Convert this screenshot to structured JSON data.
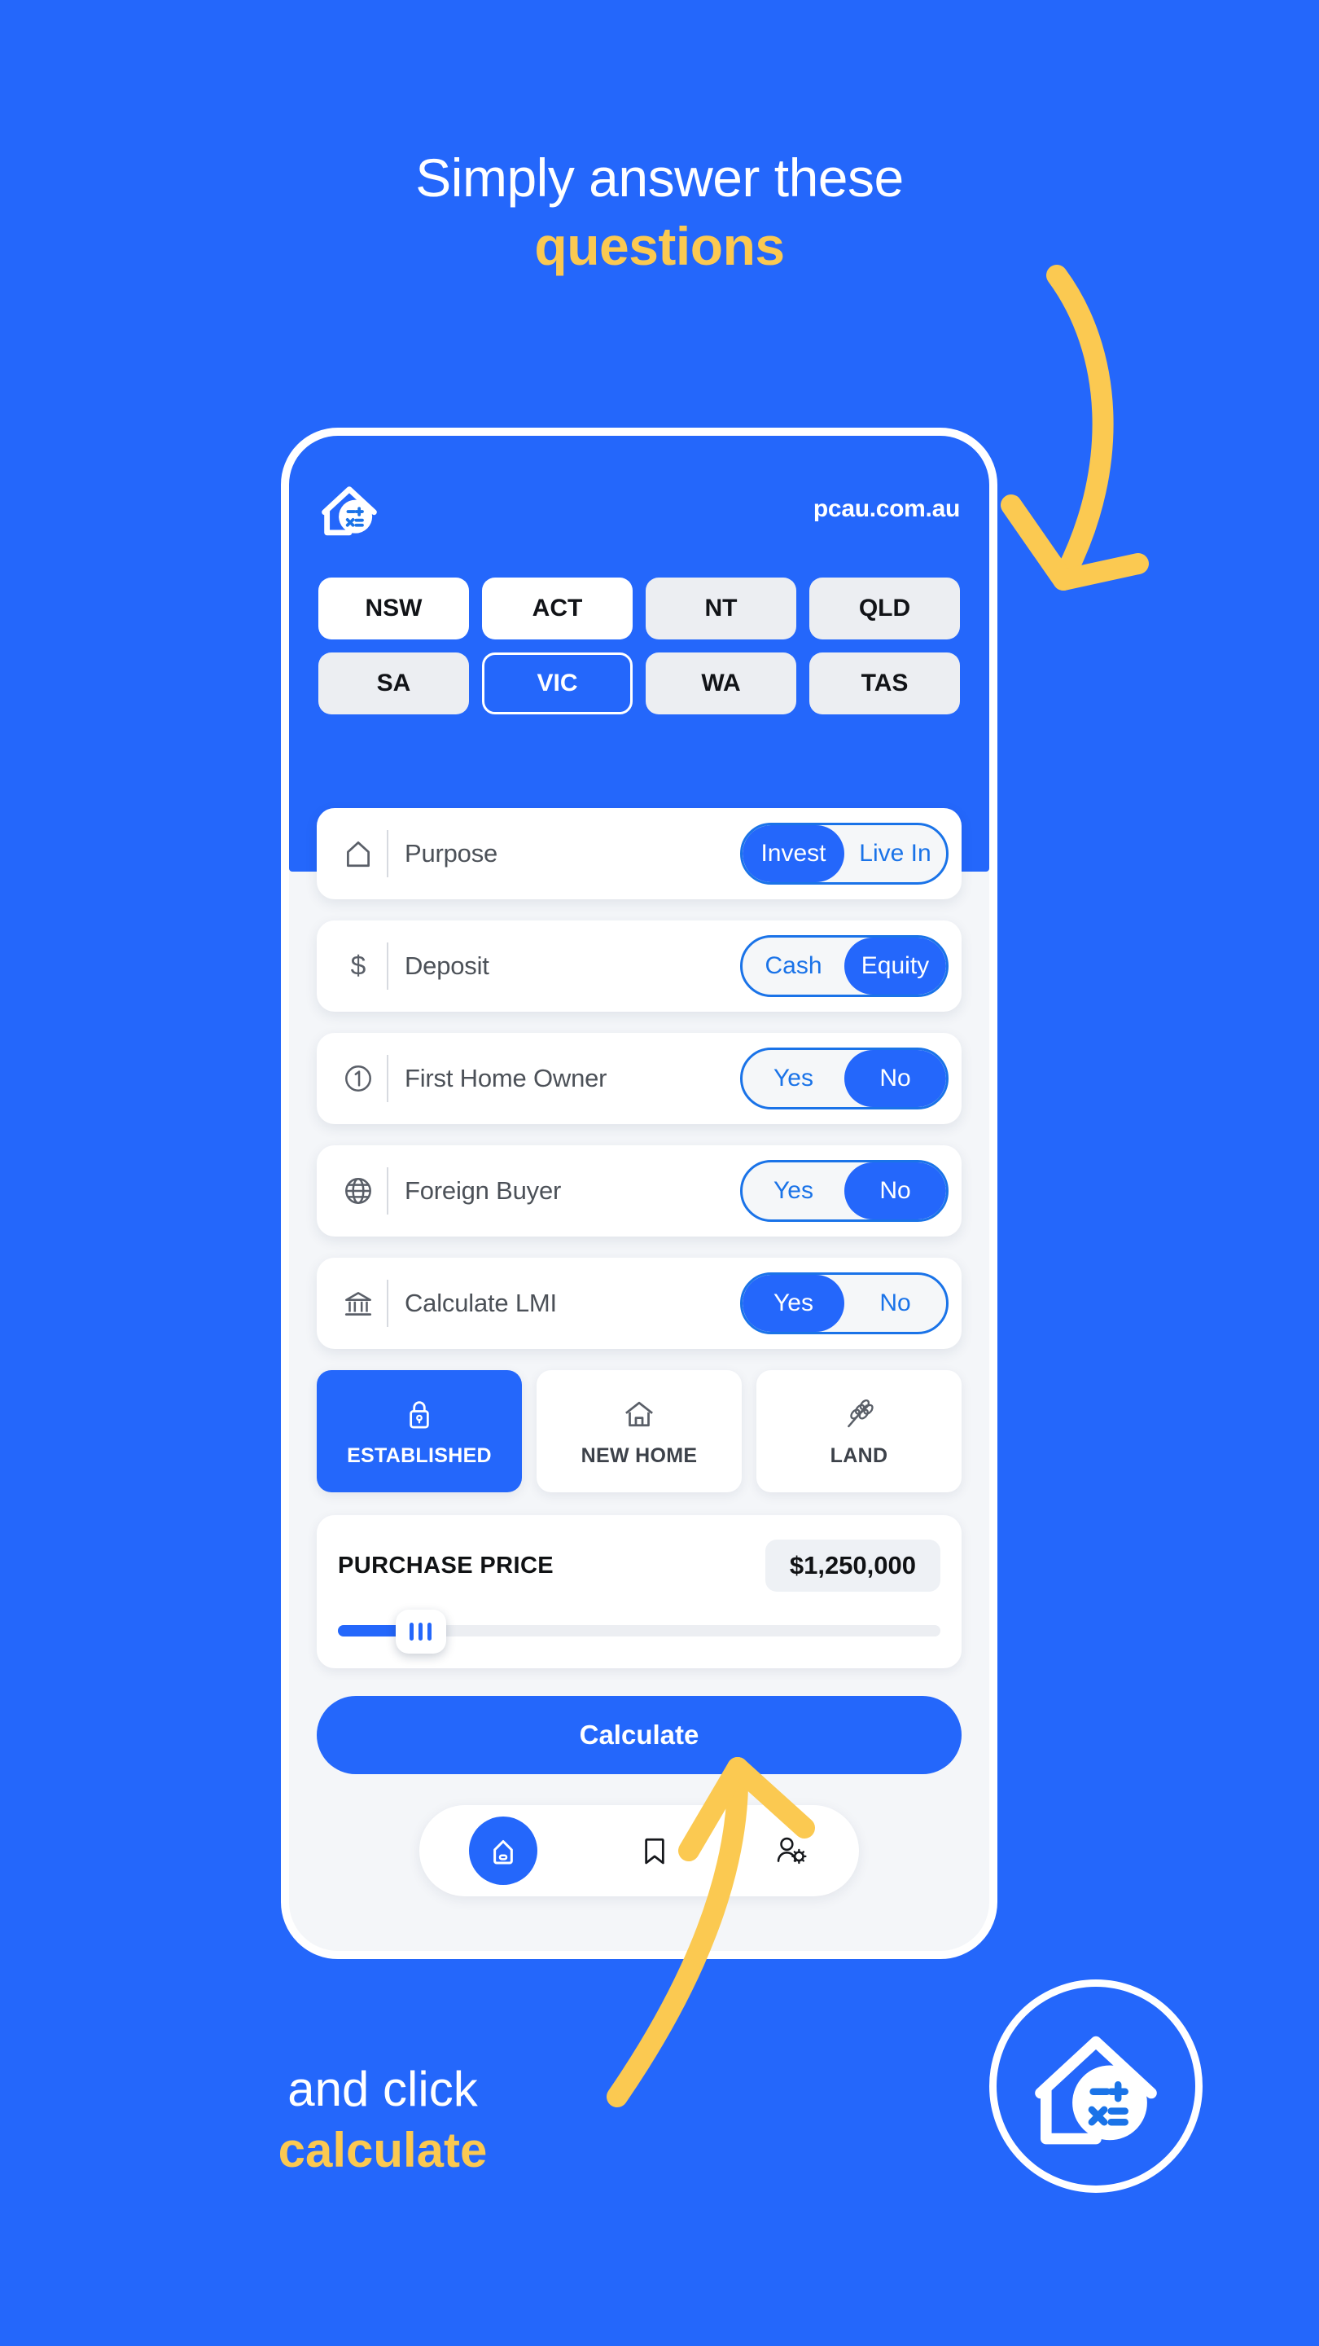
{
  "colors": {
    "brand_blue": "#2467fb",
    "accent_yellow": "#fbc951",
    "white": "#ffffff",
    "light_grey": "#f4f6f9",
    "chip_grey": "#eceef2"
  },
  "promo": {
    "top_line1": "Simply answer these",
    "top_line2": "questions",
    "bottom_line1": "and click",
    "bottom_line2": "calculate"
  },
  "phone": {
    "header": {
      "logo_icon": "house-calculator-logo-icon",
      "url": "pcau.com.au"
    },
    "states": [
      {
        "label": "NSW",
        "style": "white"
      },
      {
        "label": "ACT",
        "style": "white"
      },
      {
        "label": "NT",
        "style": "dim"
      },
      {
        "label": "QLD",
        "style": "dim"
      },
      {
        "label": "SA",
        "style": "dim"
      },
      {
        "label": "VIC",
        "style": "active"
      },
      {
        "label": "WA",
        "style": "dim"
      },
      {
        "label": "TAS",
        "style": "dim"
      }
    ],
    "selected_state": "VIC",
    "options": [
      {
        "icon": "house-outline-icon",
        "label": "Purpose",
        "left_option": "Invest",
        "right_option": "Live In",
        "selected": "Invest"
      },
      {
        "icon": "dollar-sign-icon",
        "label": "Deposit",
        "left_option": "Cash",
        "right_option": "Equity",
        "selected": "Equity"
      },
      {
        "icon": "circled-one-icon",
        "label": "First Home Owner",
        "left_option": "Yes",
        "right_option": "No",
        "selected": "No"
      },
      {
        "icon": "globe-icon",
        "label": "Foreign Buyer",
        "left_option": "Yes",
        "right_option": "No",
        "selected": "No"
      },
      {
        "icon": "bank-icon",
        "label": "Calculate LMI",
        "left_option": "Yes",
        "right_option": "No",
        "selected": "Yes"
      }
    ],
    "property_types": [
      {
        "label": "ESTABLISHED",
        "icon": "lock-icon",
        "active": true
      },
      {
        "label": "NEW HOME",
        "icon": "house-icon",
        "active": false
      },
      {
        "label": "LAND",
        "icon": "wheat-icon",
        "active": false
      }
    ],
    "price": {
      "title": "PURCHASE PRICE",
      "value": "$1,250,000",
      "slider_percent": 12
    },
    "calculate_label": "Calculate",
    "nav": [
      {
        "icon": "home-icon",
        "active": true
      },
      {
        "icon": "bookmark-icon",
        "active": false
      },
      {
        "icon": "account-settings-icon",
        "active": false
      }
    ]
  },
  "badge": {
    "icon": "house-calculator-logo-icon"
  }
}
